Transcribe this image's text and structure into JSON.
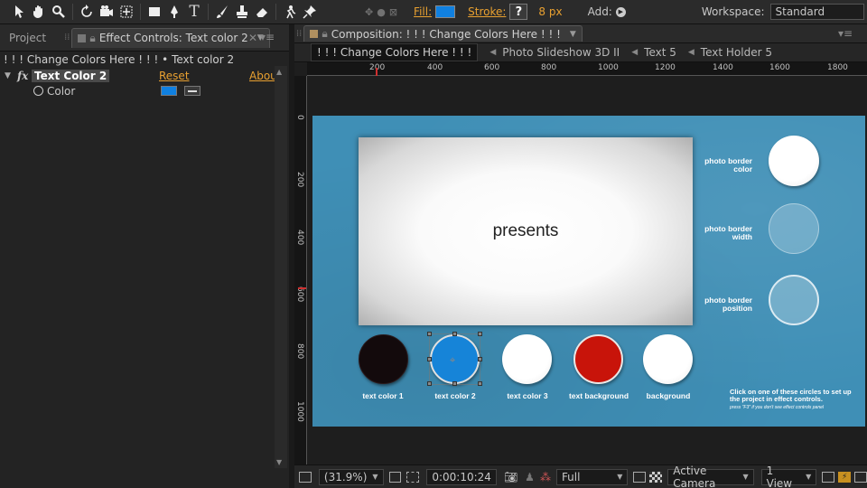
{
  "toolbar": {
    "tools": [
      "selection-tool-icon",
      "hand-tool-icon",
      "zoom-tool-icon",
      "rotation-tool-icon",
      "camera-tool-icon",
      "pan-behind-tool-icon",
      "rectangle-tool-icon",
      "pen-tool-icon",
      "type-tool-icon",
      "brush-tool-icon",
      "clone-stamp-tool-icon",
      "eraser-tool-icon",
      "roto-brush-tool-icon",
      "puppet-pin-tool-icon"
    ],
    "fill_label": "Fill:",
    "stroke_label": "Stroke:",
    "stroke_value": "?",
    "stroke_width": "8 px",
    "add_label": "Add:",
    "workspace_label": "Workspace:",
    "workspace_value": "Standard",
    "fill_color": "#1080e0"
  },
  "left_panel": {
    "project_tab": "Project",
    "effect_controls_tab": "Effect Controls: Text color 2",
    "subtitle": "! ! ! Change Colors Here ! ! ! • Text color 2",
    "effect": {
      "fx": "fx",
      "name": "Text Color 2",
      "reset": "Reset",
      "about": "About",
      "property_label": "Color",
      "property_color": "#1080e0"
    }
  },
  "comp_panel": {
    "tab_title": "Composition: ! ! ! Change Colors Here ! ! !",
    "breadcrumbs": [
      "! ! ! Change Colors Here ! ! !",
      "Photo Slideshow 3D II",
      "Text 5",
      "Text Holder 5"
    ],
    "ruler_h": [
      "200",
      "400",
      "600",
      "800",
      "1000",
      "1200",
      "1400",
      "1600",
      "1800"
    ],
    "ruler_v": [
      "0",
      "200",
      "400",
      "600",
      "800",
      "1000"
    ],
    "scene": {
      "presents": "presents",
      "options": [
        "photo border color",
        "photo border width",
        "photo border position"
      ],
      "swatches": [
        {
          "label": "text color 1",
          "color": "#130a0c"
        },
        {
          "label": "text color 2",
          "color": "#1684d8"
        },
        {
          "label": "text color 3",
          "color": "#ffffff"
        },
        {
          "label": "text background",
          "color": "#c8140a"
        },
        {
          "label": "background",
          "color": "#ffffff"
        }
      ],
      "instruction": "Click on one of these circles to set up the project in effect controls.",
      "instruction_small": "press \"F3\" if you don't see effect controls panel"
    },
    "bottom": {
      "zoom": "(31.9%)",
      "timecode": "0:00:10:24",
      "resolution": "Full",
      "camera": "Active Camera",
      "views": "1 View"
    }
  }
}
